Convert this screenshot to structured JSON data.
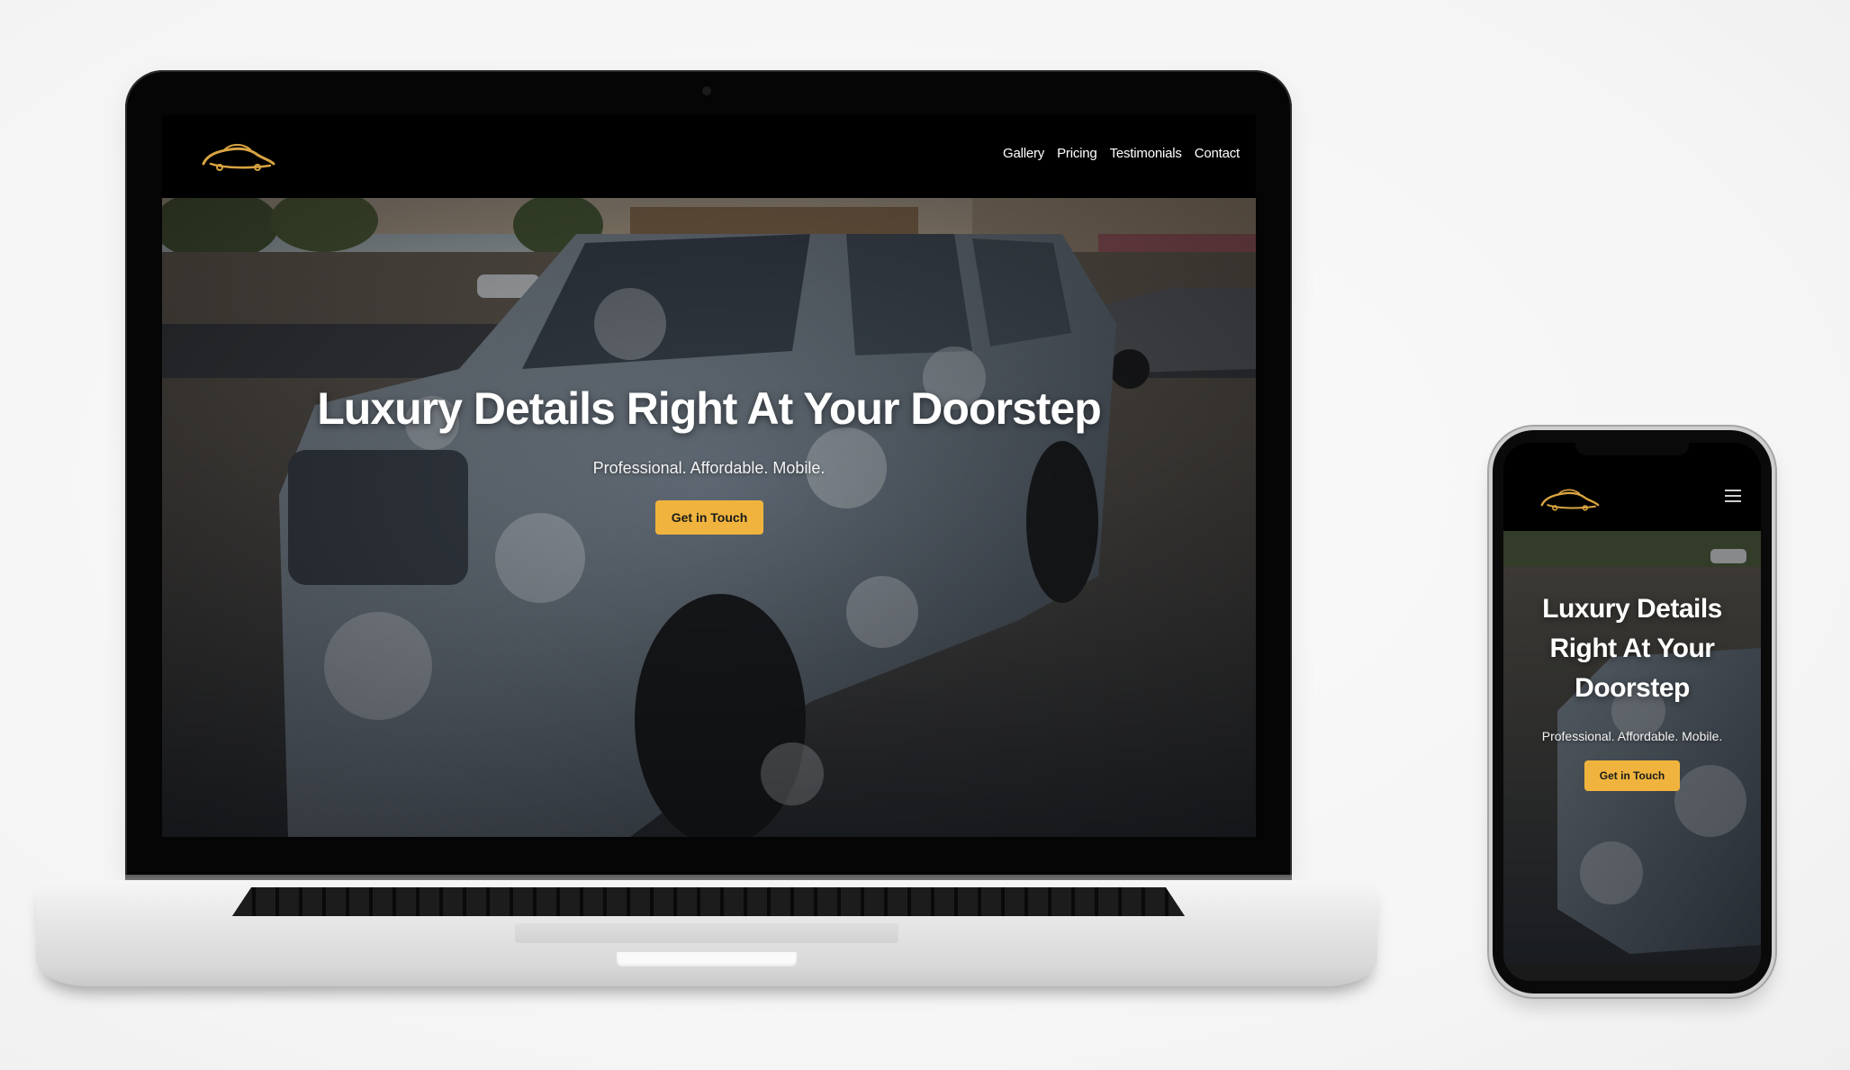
{
  "laptop_site": {
    "nav": {
      "links": [
        "Gallery",
        "Pricing",
        "Testimonials",
        "Contact"
      ]
    },
    "hero": {
      "title": "Luxury Details Right At Your Doorstep",
      "subtitle": "Professional. Affordable. Mobile.",
      "cta_label": "Get in Touch"
    }
  },
  "phone_site": {
    "hero": {
      "title_lines": [
        "Luxury Details",
        "Right At Your",
        "Doorstep"
      ],
      "subtitle": "Professional. Affordable. Mobile.",
      "cta_label": "Get in Touch"
    }
  },
  "colors": {
    "accent": "#f0b43e",
    "nav_background": "#000000",
    "logo_gold": "#d9a441"
  },
  "icons": {
    "logo": "car-outline-logo",
    "menu": "hamburger-menu-icon"
  }
}
